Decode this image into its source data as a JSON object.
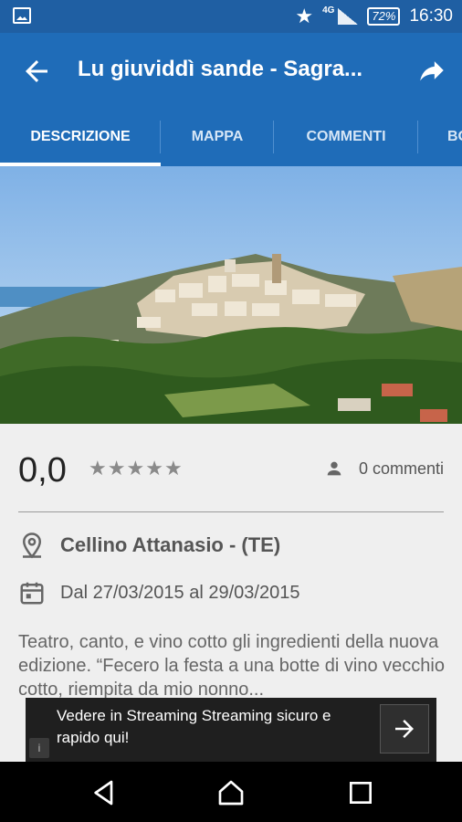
{
  "status": {
    "network": "4G",
    "battery": "72%",
    "time": "16:30"
  },
  "appbar": {
    "title": "Lu giuviddì sande - Sagra..."
  },
  "tabs": [
    {
      "label": "DESCRIZIONE"
    },
    {
      "label": "MAPPA"
    },
    {
      "label": "COMMENTI"
    },
    {
      "label": "BO"
    }
  ],
  "detail": {
    "rating": "0,0",
    "stars_filled": 0,
    "stars_total": 5,
    "comments": "0 commenti",
    "location": "Cellino Attanasio - (TE)",
    "dates": "Dal 27/03/2015 al 29/03/2015",
    "description": "Teatro, canto, e vino cotto gli ingredienti della nuova edizione. “Fecero la festa a una botte di vino vecchio cotto, riempita da mio nonno..."
  },
  "ad": {
    "text": "Vedere in Streaming Streaming sicuro e rapido qui!",
    "info": "i"
  },
  "colors": {
    "appbar": "#1f6cb8",
    "statusbar": "#1f5fa3"
  }
}
